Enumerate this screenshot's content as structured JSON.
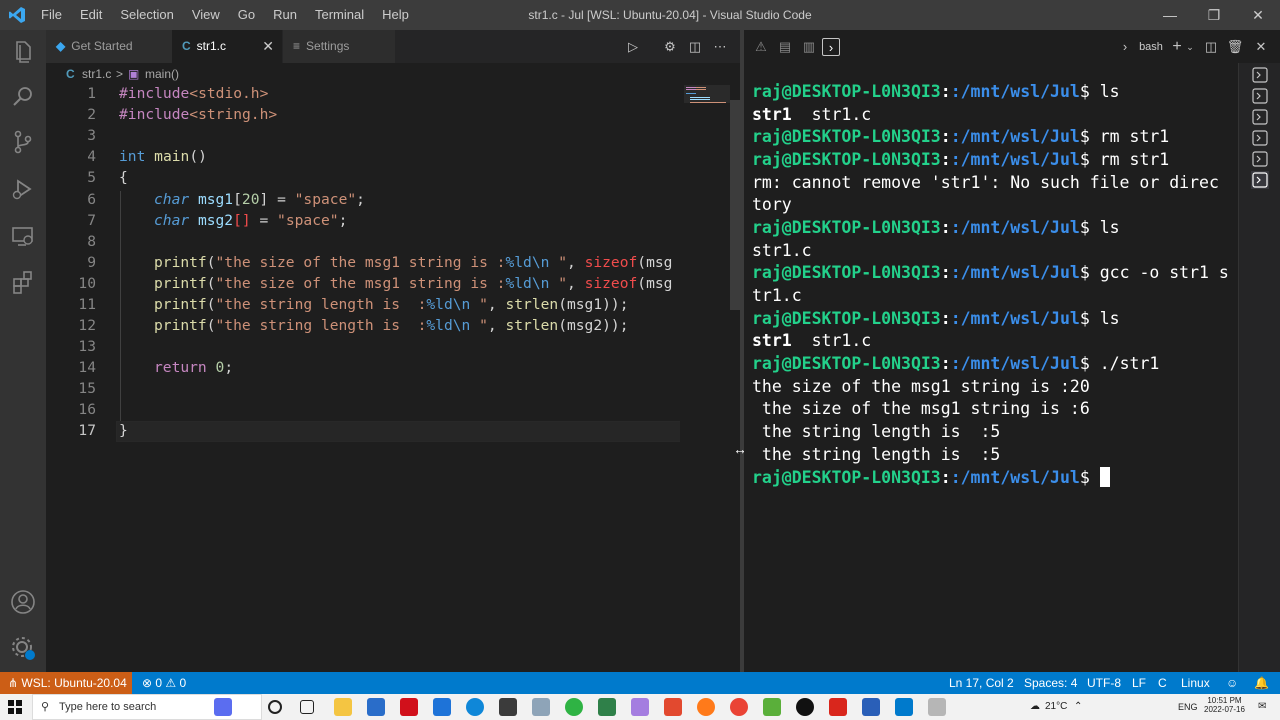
{
  "window": {
    "title": "str1.c - Jul [WSL: Ubuntu-20.04] - Visual Studio Code",
    "menu": [
      "File",
      "Edit",
      "Selection",
      "View",
      "Go",
      "Run",
      "Terminal",
      "Help"
    ]
  },
  "tabs": [
    {
      "label": "Get Started",
      "icon": "vscode-icon"
    },
    {
      "label": "str1.c",
      "icon": "C",
      "active": true
    },
    {
      "label": "Settings",
      "icon": "settings-icon"
    }
  ],
  "breadcrumb": {
    "file_icon": "C",
    "file": "str1.c",
    "separator": ">",
    "symbol": "main()"
  },
  "editor": {
    "line_numbers": [
      "1",
      "2",
      "3",
      "4",
      "5",
      "6",
      "7",
      "8",
      "9",
      "10",
      "11",
      "12",
      "13",
      "14",
      "15",
      "16",
      "17"
    ],
    "current_line": 17,
    "lines": {
      "l1_pre": "#include",
      "l1_rest": "<stdio.h>",
      "l2_pre": "#include",
      "l2_rest": "<string.h>",
      "l4_type": "int",
      "l4_fn": "main",
      "l4_rest": "()",
      "l5": "{",
      "l6_type": "char",
      "l6_var": "msg1",
      "l6_b1": "[",
      "l6_num": "20",
      "l6_b2": "]",
      "l6_eq": " = ",
      "l6_str": "\"space\"",
      "l6_end": ";",
      "l7_type": "char",
      "l7_var": "msg2",
      "l7_err": "[]",
      "l7_eq": " = ",
      "l7_str": "\"space\"",
      "l7_end": ";",
      "l9_fn": "printf",
      "l9_p": "(",
      "l9_str1": "\"the size of the msg1 string is :",
      "l9_fmt": "%ld\\n",
      "l9_str2": " \"",
      "l9_comma": ", ",
      "l9_kw": "sizeof",
      "l9_rest": "(msg",
      "l10_fn": "printf",
      "l10_p": "(",
      "l10_str1": "\"the size of the msg1 string is :",
      "l10_fmt": "%ld\\n",
      "l10_str2": " \"",
      "l10_comma": ", ",
      "l10_kw": "sizeof",
      "l10_rest": "(msg",
      "l11_fn": "printf",
      "l11_p": "(",
      "l11_str1": "\"the string length is  :",
      "l11_fmt": "%ld\\n",
      "l11_str2": " \"",
      "l11_comma": ", ",
      "l11_fn2": "strlen",
      "l11_rest": "(msg1));",
      "l12_fn": "printf",
      "l12_p": "(",
      "l12_str1": "\"the string length is  :",
      "l12_fmt": "%ld\\n",
      "l12_str2": " \"",
      "l12_comma": ", ",
      "l12_fn2": "strlen",
      "l12_rest": "(msg2));",
      "l14_kw": "return",
      "l14_sp": " ",
      "l14_num": "0",
      "l14_end": ";",
      "l17": "}"
    }
  },
  "terminal": {
    "shell_label": "bash",
    "prompt_user": "raj@DESKTOP-L0N3QI3",
    "prompt_path": ":/mnt/wsl/Jul",
    "prompt_sym": "$ ",
    "lines": {
      "c1": "ls",
      "o1a": "str1",
      "o1b": "  str1.c",
      "c2": "rm str1",
      "c3": "rm str1",
      "o3a": "rm: cannot remove 'str1': No such file or direc",
      "o3b": "tory",
      "c4": "ls",
      "o4": "str1.c",
      "c5": "gcc -o str1 s",
      "o5": "tr1.c",
      "c6": "ls",
      "o6a": "str1",
      "o6b": "  str1.c",
      "c7": "./str1",
      "o7a": "the size of the msg1 string is :20",
      "o7b": " the size of the msg1 string is :6",
      "o7c": " the string length is  :5",
      "o7d": " the string length is  :5"
    }
  },
  "statusbar": {
    "remote": "WSL: Ubuntu-20.04",
    "errors": "0",
    "warnings": "0",
    "position": "Ln 17, Col 2",
    "spaces": "Spaces: 4",
    "encoding": "UTF-8",
    "eol": "LF",
    "language": "C",
    "platform": "Linux"
  },
  "taskbar": {
    "search_placeholder": "Type here to search",
    "weather": "21°C",
    "lang": "ENG",
    "time": "10:51 PM",
    "date": "2022-07-16"
  },
  "colors": {
    "accent": "#007acc",
    "remote": "#cc5e16",
    "prompt_user": "#23d18b",
    "prompt_path": "#3b8eea"
  }
}
